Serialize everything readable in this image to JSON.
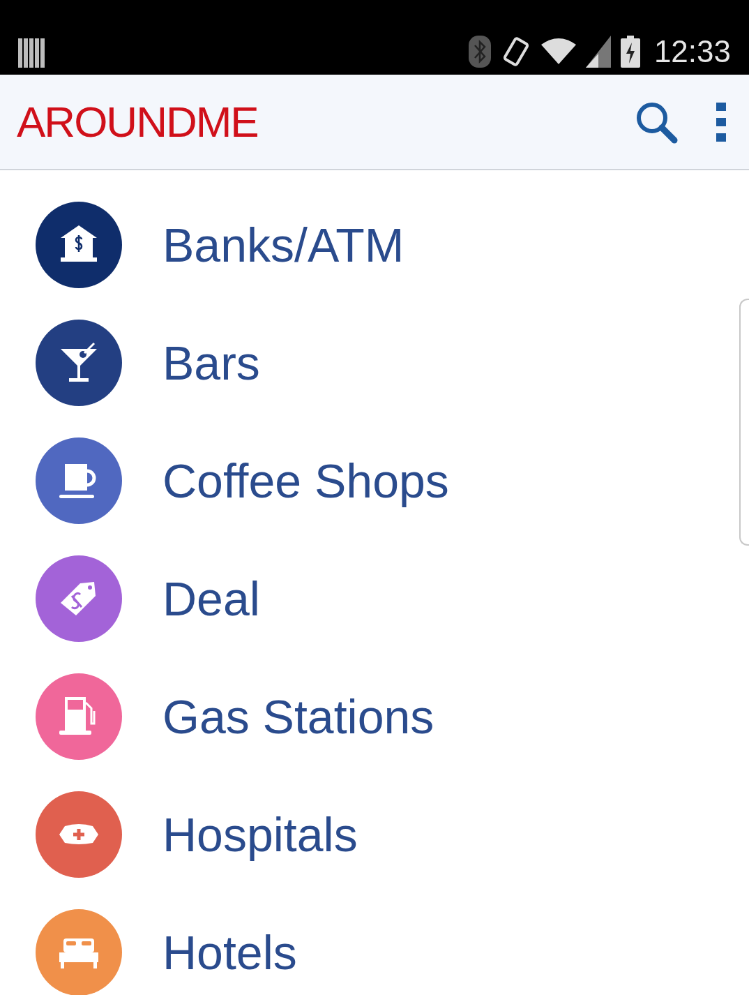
{
  "status_bar": {
    "time": "12:33"
  },
  "app_bar": {
    "title": "AROUNDME"
  },
  "categories": [
    {
      "label": "Banks/ATM",
      "color": "#0f2d6b"
    },
    {
      "label": "Bars",
      "color": "#233f82"
    },
    {
      "label": "Coffee Shops",
      "color": "#5068c0"
    },
    {
      "label": "Deal",
      "color": "#a363d8"
    },
    {
      "label": "Gas Stations",
      "color": "#f0679a"
    },
    {
      "label": "Hospitals",
      "color": "#e0604f"
    },
    {
      "label": "Hotels",
      "color": "#f0904a"
    }
  ]
}
